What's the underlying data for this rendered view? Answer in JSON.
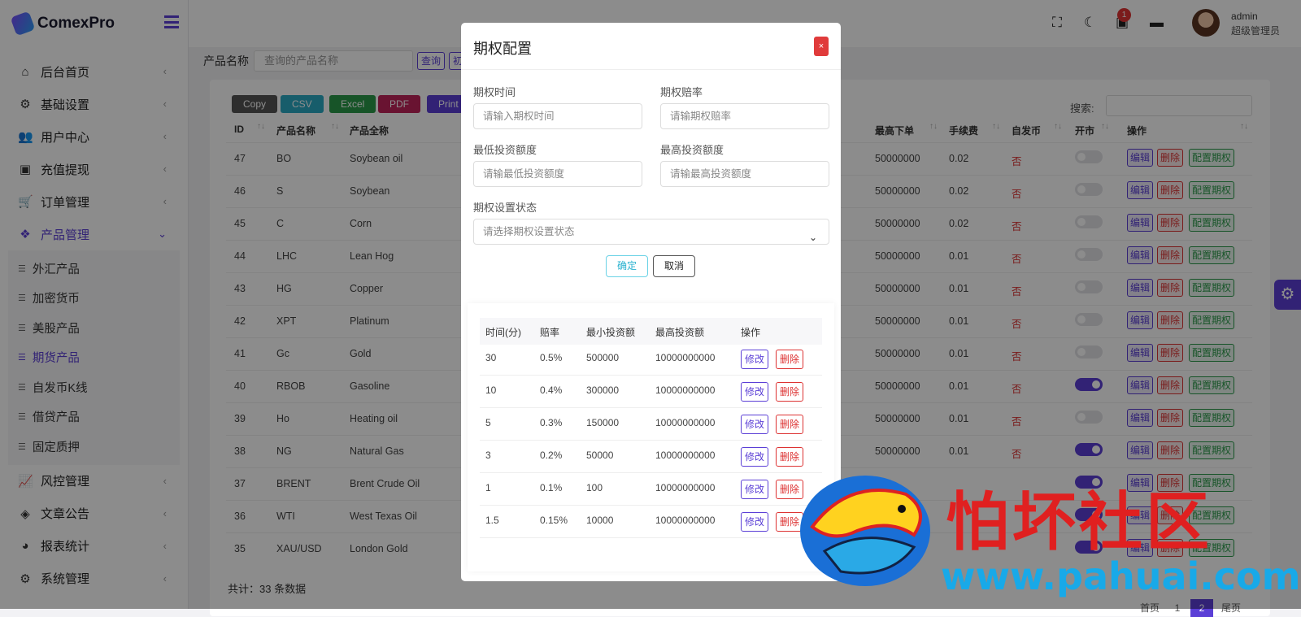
{
  "app": {
    "name": "ComexPro"
  },
  "topbar": {
    "badge_count": "1",
    "user_name": "admin",
    "user_role": "超级管理员"
  },
  "sidebar": {
    "items": [
      {
        "label": "后台首页",
        "icon": "home-icon"
      },
      {
        "label": "基础设置",
        "icon": "cogs-icon"
      },
      {
        "label": "用户中心",
        "icon": "users-icon"
      },
      {
        "label": "充值提现",
        "icon": "money-icon"
      },
      {
        "label": "订单管理",
        "icon": "cart-icon"
      },
      {
        "label": "产品管理",
        "icon": "cubes-icon"
      }
    ],
    "sub_items": [
      "外汇产品",
      "加密货币",
      "美股产品",
      "期货产品",
      "自发币K线",
      "借贷产品",
      "固定质押"
    ],
    "items_after": [
      {
        "label": "风控管理",
        "icon": "chart-line-icon"
      },
      {
        "label": "文章公告",
        "icon": "layers-icon"
      },
      {
        "label": "报表统计",
        "icon": "pie-chart-icon"
      },
      {
        "label": "系统管理",
        "icon": "gear-icon"
      }
    ]
  },
  "filter": {
    "label": "产品名称",
    "placeholder": "查询的产品名称",
    "query_btn": "查询",
    "extra_btn": "初"
  },
  "export_buttons": [
    "Copy",
    "CSV",
    "Excel",
    "PDF",
    "Print"
  ],
  "search_label": "搜索:",
  "table": {
    "headers": [
      "ID",
      "产品名称",
      "产品全称",
      "最高下单",
      "手续费",
      "自发币",
      "开市",
      "操作"
    ],
    "rows": [
      {
        "id": "47",
        "name": "BO",
        "full": "Soybean oil",
        "max": "50000000",
        "fee": "0.02",
        "self": "否",
        "open": false
      },
      {
        "id": "46",
        "name": "S",
        "full": "Soybean",
        "max": "50000000",
        "fee": "0.02",
        "self": "否",
        "open": false
      },
      {
        "id": "45",
        "name": "C",
        "full": "Corn",
        "max": "50000000",
        "fee": "0.02",
        "self": "否",
        "open": false
      },
      {
        "id": "44",
        "name": "LHC",
        "full": "Lean Hog",
        "max": "50000000",
        "fee": "0.01",
        "self": "否",
        "open": false
      },
      {
        "id": "43",
        "name": "HG",
        "full": "Copper",
        "max": "50000000",
        "fee": "0.01",
        "self": "否",
        "open": false
      },
      {
        "id": "42",
        "name": "XPT",
        "full": "Platinum",
        "max": "50000000",
        "fee": "0.01",
        "self": "否",
        "open": false
      },
      {
        "id": "41",
        "name": "Gc",
        "full": "Gold",
        "max": "50000000",
        "fee": "0.01",
        "self": "否",
        "open": false
      },
      {
        "id": "40",
        "name": "RBOB",
        "full": "Gasoline",
        "max": "50000000",
        "fee": "0.01",
        "self": "否",
        "open": true
      },
      {
        "id": "39",
        "name": "Ho",
        "full": "Heating oil",
        "max": "50000000",
        "fee": "0.01",
        "self": "否",
        "open": false
      },
      {
        "id": "38",
        "name": "NG",
        "full": "Natural Gas",
        "max": "50000000",
        "fee": "0.01",
        "self": "否",
        "open": true
      },
      {
        "id": "37",
        "name": "BRENT",
        "full": "Brent Crude Oil",
        "max": "",
        "fee": "",
        "self": "",
        "open": true
      },
      {
        "id": "36",
        "name": "WTI",
        "full": "West Texas Oil",
        "max": "",
        "fee": "",
        "self": "",
        "open": true
      },
      {
        "id": "35",
        "name": "XAU/USD",
        "full": "London Gold",
        "max": "",
        "fee": "",
        "self": "",
        "open": true
      }
    ],
    "action_labels": {
      "edit": "编辑",
      "delete": "删除",
      "config": "配置期权"
    }
  },
  "footer": {
    "total": "共计：33 条数据",
    "pages": [
      "首页",
      "1",
      "2",
      "尾页"
    ]
  },
  "modal": {
    "title": "期权配置",
    "close": "×",
    "fields": {
      "time_label": "期权时间",
      "time_placeholder": "请输入期权时间",
      "rate_label": "期权赔率",
      "rate_placeholder": "请输期权赔率",
      "min_label": "最低投资额度",
      "min_placeholder": "请输最低投资额度",
      "max_label": "最高投资额度",
      "max_placeholder": "请输最高投资额度",
      "status_label": "期权设置状态",
      "status_placeholder": "请选择期权设置状态"
    },
    "ok": "确定",
    "cancel": "取消",
    "inner_headers": [
      "时间(分)",
      "赔率",
      "最小投资额",
      "最高投资额",
      "操作"
    ],
    "inner_rows": [
      {
        "t": "30",
        "r": "0.5%",
        "min": "500000",
        "max": "10000000000"
      },
      {
        "t": "10",
        "r": "0.4%",
        "min": "300000",
        "max": "10000000000"
      },
      {
        "t": "5",
        "r": "0.3%",
        "min": "150000",
        "max": "10000000000"
      },
      {
        "t": "3",
        "r": "0.2%",
        "min": "50000",
        "max": "10000000000"
      },
      {
        "t": "1",
        "r": "0.1%",
        "min": "100",
        "max": "10000000000"
      },
      {
        "t": "1.5",
        "r": "0.15%",
        "min": "10000",
        "max": "10000000000"
      }
    ],
    "inner_actions": {
      "edit": "修改",
      "delete": "删除"
    }
  },
  "watermark": {
    "text": "怕坏社区",
    "url": "www.pahuai.com"
  },
  "colors": {
    "accent": "#5b3fd6",
    "danger": "#dd3333",
    "success": "#2b9a4a",
    "info": "#2ab2cf"
  }
}
